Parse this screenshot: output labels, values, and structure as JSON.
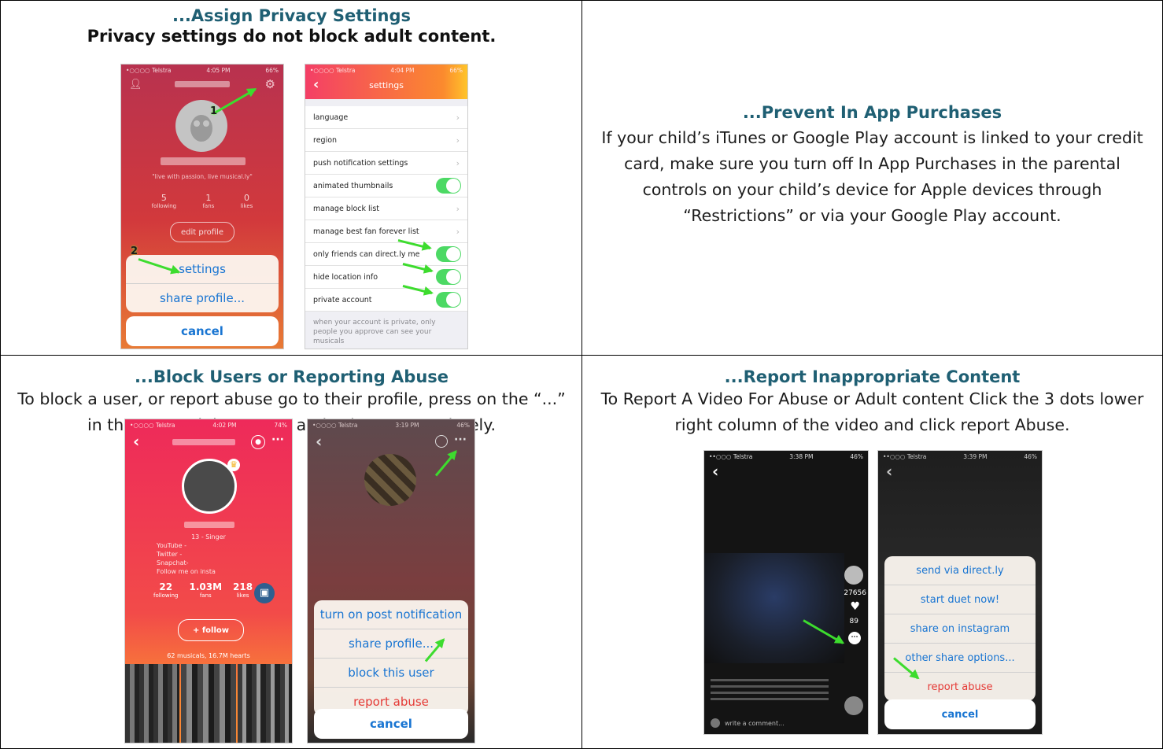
{
  "sections": {
    "privacy": {
      "title": "...Assign Privacy Settings",
      "subtitle": "Privacy settings do not block adult content."
    },
    "purchases": {
      "title": "...Prevent In App Purchases",
      "body": "If your child’s iTunes or Google Play account is linked to your credit card, make sure you turn off In App Purchases in the parental controls on your child’s device for Apple devices through “Restrictions” or via your Google Play account."
    },
    "block": {
      "title": "...Block Users or Reporting Abuse",
      "body": "To block a user, or report abuse go to their profile, press on the “...” in the upper right corner, and select appropriately."
    },
    "report": {
      "title": "...Report Inappropriate Content",
      "body": "To Report A Video For Abuse or Adult content Click the 3 dots lower right column of the video and click report Abuse."
    }
  },
  "shot1": {
    "carrier": "•○○○○ Telstra",
    "time": "4:05 PM",
    "battery": "66%",
    "quote": "\"live with passion, live musical.ly\"",
    "stats": [
      {
        "n": "5",
        "l": "following"
      },
      {
        "n": "1",
        "l": "fans"
      },
      {
        "n": "0",
        "l": "likes"
      }
    ],
    "edit_profile": "edit profile",
    "options": [
      "settings",
      "share profile..."
    ],
    "cancel": "cancel",
    "markers": [
      "1",
      "2"
    ]
  },
  "shot2": {
    "carrier": "•○○○○ Telstra",
    "time": "4:04 PM",
    "battery": "66%",
    "title": "settings",
    "rows": [
      {
        "label": "language",
        "kind": "chevron"
      },
      {
        "label": "region",
        "kind": "chevron"
      },
      {
        "label": "push notification settings",
        "kind": "chevron"
      },
      {
        "label": "animated thumbnails",
        "kind": "toggle"
      },
      {
        "label": "manage block list",
        "kind": "chevron"
      },
      {
        "label": "manage best fan forever list",
        "kind": "chevron"
      },
      {
        "label": "only friends can direct.ly me",
        "kind": "toggle"
      },
      {
        "label": "hide location info",
        "kind": "toggle"
      },
      {
        "label": "private account",
        "kind": "toggle"
      }
    ],
    "footer": "when your account is private, only people you approve can see your musicals"
  },
  "shot3": {
    "carrier": "•○○○○ Telstra",
    "time": "4:02 PM",
    "battery": "74%",
    "bio": [
      "13 - Singer",
      "YouTube -",
      "Twitter -",
      "Snapchat-",
      "Follow me on insta"
    ],
    "stats": [
      {
        "n": "22",
        "l": "following"
      },
      {
        "n": "1.03M",
        "l": "fans"
      },
      {
        "n": "218",
        "l": "likes"
      }
    ],
    "follow": "+ follow",
    "musicals": "62 musicals, 16.7M hearts"
  },
  "shot4": {
    "carrier": "•○○○○ Telstra",
    "time": "3:19 PM",
    "battery": "46%",
    "options": [
      "turn on post notification",
      "share profile...",
      "block this user",
      "report abuse"
    ],
    "cancel": "cancel"
  },
  "shot5": {
    "carrier": "••○○○ Telstra",
    "time": "3:38 PM",
    "battery": "46%",
    "likes": "27656",
    "comments": "89",
    "comment_placeholder": "write a comment..."
  },
  "shot6": {
    "carrier": "••○○○ Telstra",
    "time": "3:39 PM",
    "battery": "46%",
    "options": [
      "send via direct.ly",
      "start duet now!",
      "share on instagram",
      "other share options...",
      "report abuse"
    ],
    "cancel": "cancel"
  },
  "colors": {
    "heading": "#1f5f73",
    "ios_blue": "#1975d2",
    "ios_red": "#e53935",
    "arrow_green": "#3ddc2e",
    "toggle_green": "#4cd964"
  }
}
